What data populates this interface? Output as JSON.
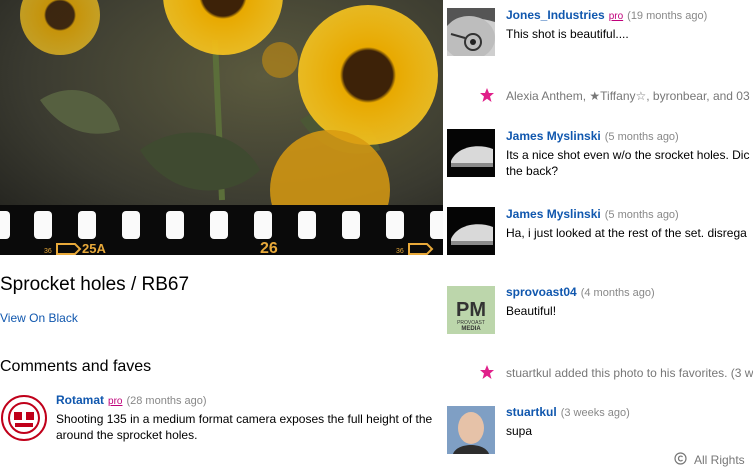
{
  "photo": {
    "frame_labels": [
      "36",
      "25A",
      "26",
      "36"
    ]
  },
  "title": "Sprocket holes / RB67",
  "view_on_black": "View On Black",
  "comments_heading": "Comments and faves",
  "left_comments": [
    {
      "name": "Rotamat",
      "pro": "pro",
      "ago": "(28 months ago)",
      "text1": "Shooting 135 in a medium format camera exposes the full height of the",
      "text2": "around the sprocket holes."
    }
  ],
  "right_comments": [
    {
      "name": "Jones_Industries",
      "pro": "pro",
      "ago": "(19 months ago)",
      "text1": "This shot is beautiful....",
      "text2": ""
    },
    {
      "name": "James Myslinski",
      "pro": "",
      "ago": "(5 months ago)",
      "text1": "Its a nice shot even w/o the srocket holes. Dic",
      "text2": "the back?"
    },
    {
      "name": "James Myslinski",
      "pro": "",
      "ago": "(5 months ago)",
      "text1": "Ha, i just looked at the rest of the set. disrega",
      "text2": ""
    },
    {
      "name": "sprovoast04",
      "pro": "",
      "ago": "(4 months ago)",
      "text1": "Beautiful!",
      "text2": ""
    },
    {
      "name": "stuartkul",
      "pro": "",
      "ago": "(3 weeks ago)",
      "text1": "supa",
      "text2": ""
    }
  ],
  "faves": [
    {
      "text": "Alexia Anthem, ★Tiffany☆, byronbear, and 03"
    },
    {
      "text": "stuartkul added this photo to his favorites. (3 w"
    }
  ],
  "avatar_text": {
    "pm": "PM",
    "pm_sub1": "PROVOAST",
    "pm_sub2": "MEDIA"
  },
  "footer": "All Rights"
}
